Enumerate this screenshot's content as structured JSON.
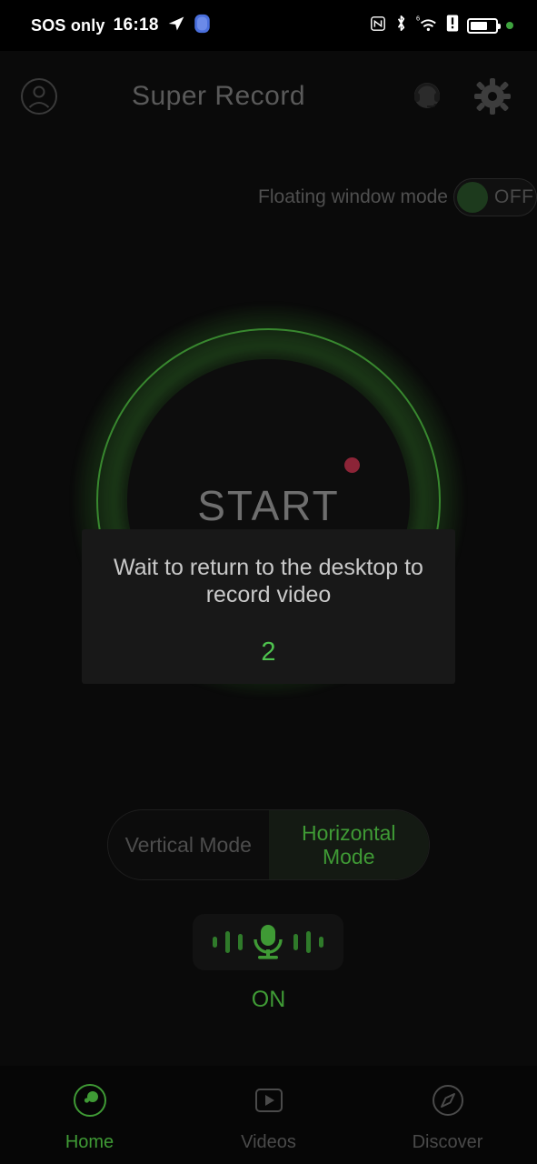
{
  "statusbar": {
    "carrier": "SOS only",
    "time": "16:18",
    "icons_left": [
      "telegram-icon",
      "shield-icon"
    ],
    "icons_right": [
      "nfc-icon",
      "bluetooth-icon",
      "wifi6-icon",
      "alert-icon",
      "battery-icon",
      "green-dot-indicator"
    ],
    "battery_level_pct": 60
  },
  "header": {
    "title": "Super Record",
    "account_icon": "account-circle-icon",
    "support_icon": "headset-support-icon",
    "settings_icon": "gear-icon"
  },
  "floating_window": {
    "label": "Floating window mode",
    "state": "OFF",
    "enabled": false
  },
  "record": {
    "button_label": "START",
    "recording_dot_color": "#8c2437",
    "ring_color": "#3f9a35"
  },
  "dialog": {
    "message": "Wait to return to the desktop to record video",
    "countdown": "2",
    "countdown_color": "#4ec24e"
  },
  "mode_switch": {
    "options": [
      {
        "label": "Vertical Mode",
        "active": false
      },
      {
        "label": "Horizontal Mode",
        "active": true
      }
    ]
  },
  "microphone": {
    "icon": "microphone-icon",
    "state": "ON",
    "enabled": true
  },
  "bottom_nav": {
    "items": [
      {
        "label": "Home",
        "icon": "home-record-icon",
        "active": true
      },
      {
        "label": "Videos",
        "icon": "video-play-icon",
        "active": false
      },
      {
        "label": "Discover",
        "icon": "compass-icon",
        "active": false
      }
    ]
  },
  "colors": {
    "accent_green": "#3f9a35",
    "bright_green": "#4ec24e",
    "background": "#050505",
    "dialog_bg": "#181818",
    "record_red": "#8c2437"
  }
}
